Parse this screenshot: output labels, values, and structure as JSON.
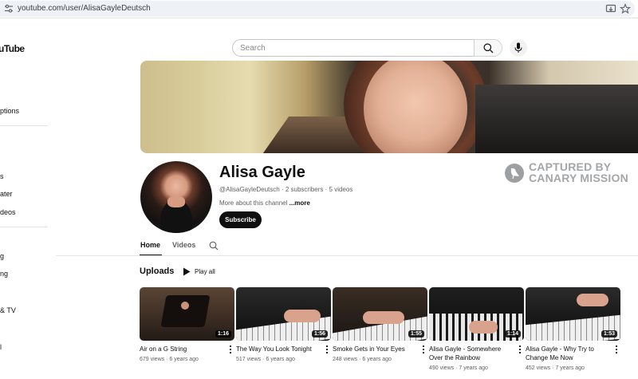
{
  "browser": {
    "url": "youtube.com/user/AlisaGayleDeutsch"
  },
  "header": {
    "logo_text": "uTube",
    "search_placeholder": "Search"
  },
  "sidebar": {
    "items": [
      "ptions",
      "s",
      "ater",
      "deos",
      "g",
      "ng",
      "& TV",
      "l"
    ]
  },
  "channel": {
    "name": "Alisa Gayle",
    "handle": "@AlisaGayleDeutsch",
    "subscribers": "2 subscribers",
    "videos_count": "5 videos",
    "about": "More about this channel",
    "more_link": "...more",
    "subscribe_label": "Subscribe"
  },
  "watermark": {
    "line1": "CAPTURED BY",
    "line2": "CANARY MISSION"
  },
  "tabs": [
    {
      "label": "Home",
      "active": true
    },
    {
      "label": "Videos",
      "active": false
    }
  ],
  "uploads": {
    "title": "Uploads",
    "play_all": "Play all",
    "videos": [
      {
        "title": "Air on a G String",
        "views": "679 views",
        "age": "6 years ago",
        "duration": "1:16"
      },
      {
        "title": "The Way You Look Tonight",
        "views": "517 views",
        "age": "6 years ago",
        "duration": "1:56"
      },
      {
        "title": "Smoke Gets in Your Eyes",
        "views": "248 views",
        "age": "6 years ago",
        "duration": "1:55"
      },
      {
        "title": "Alisa Gayle - Somewhere Over the Rainbow",
        "views": "490 views",
        "age": "7 years ago",
        "duration": "1:14"
      },
      {
        "title": "Alisa Gayle - Why Try to Change Me Now",
        "views": "452 views",
        "age": "7 years ago",
        "duration": "1:53"
      }
    ]
  }
}
